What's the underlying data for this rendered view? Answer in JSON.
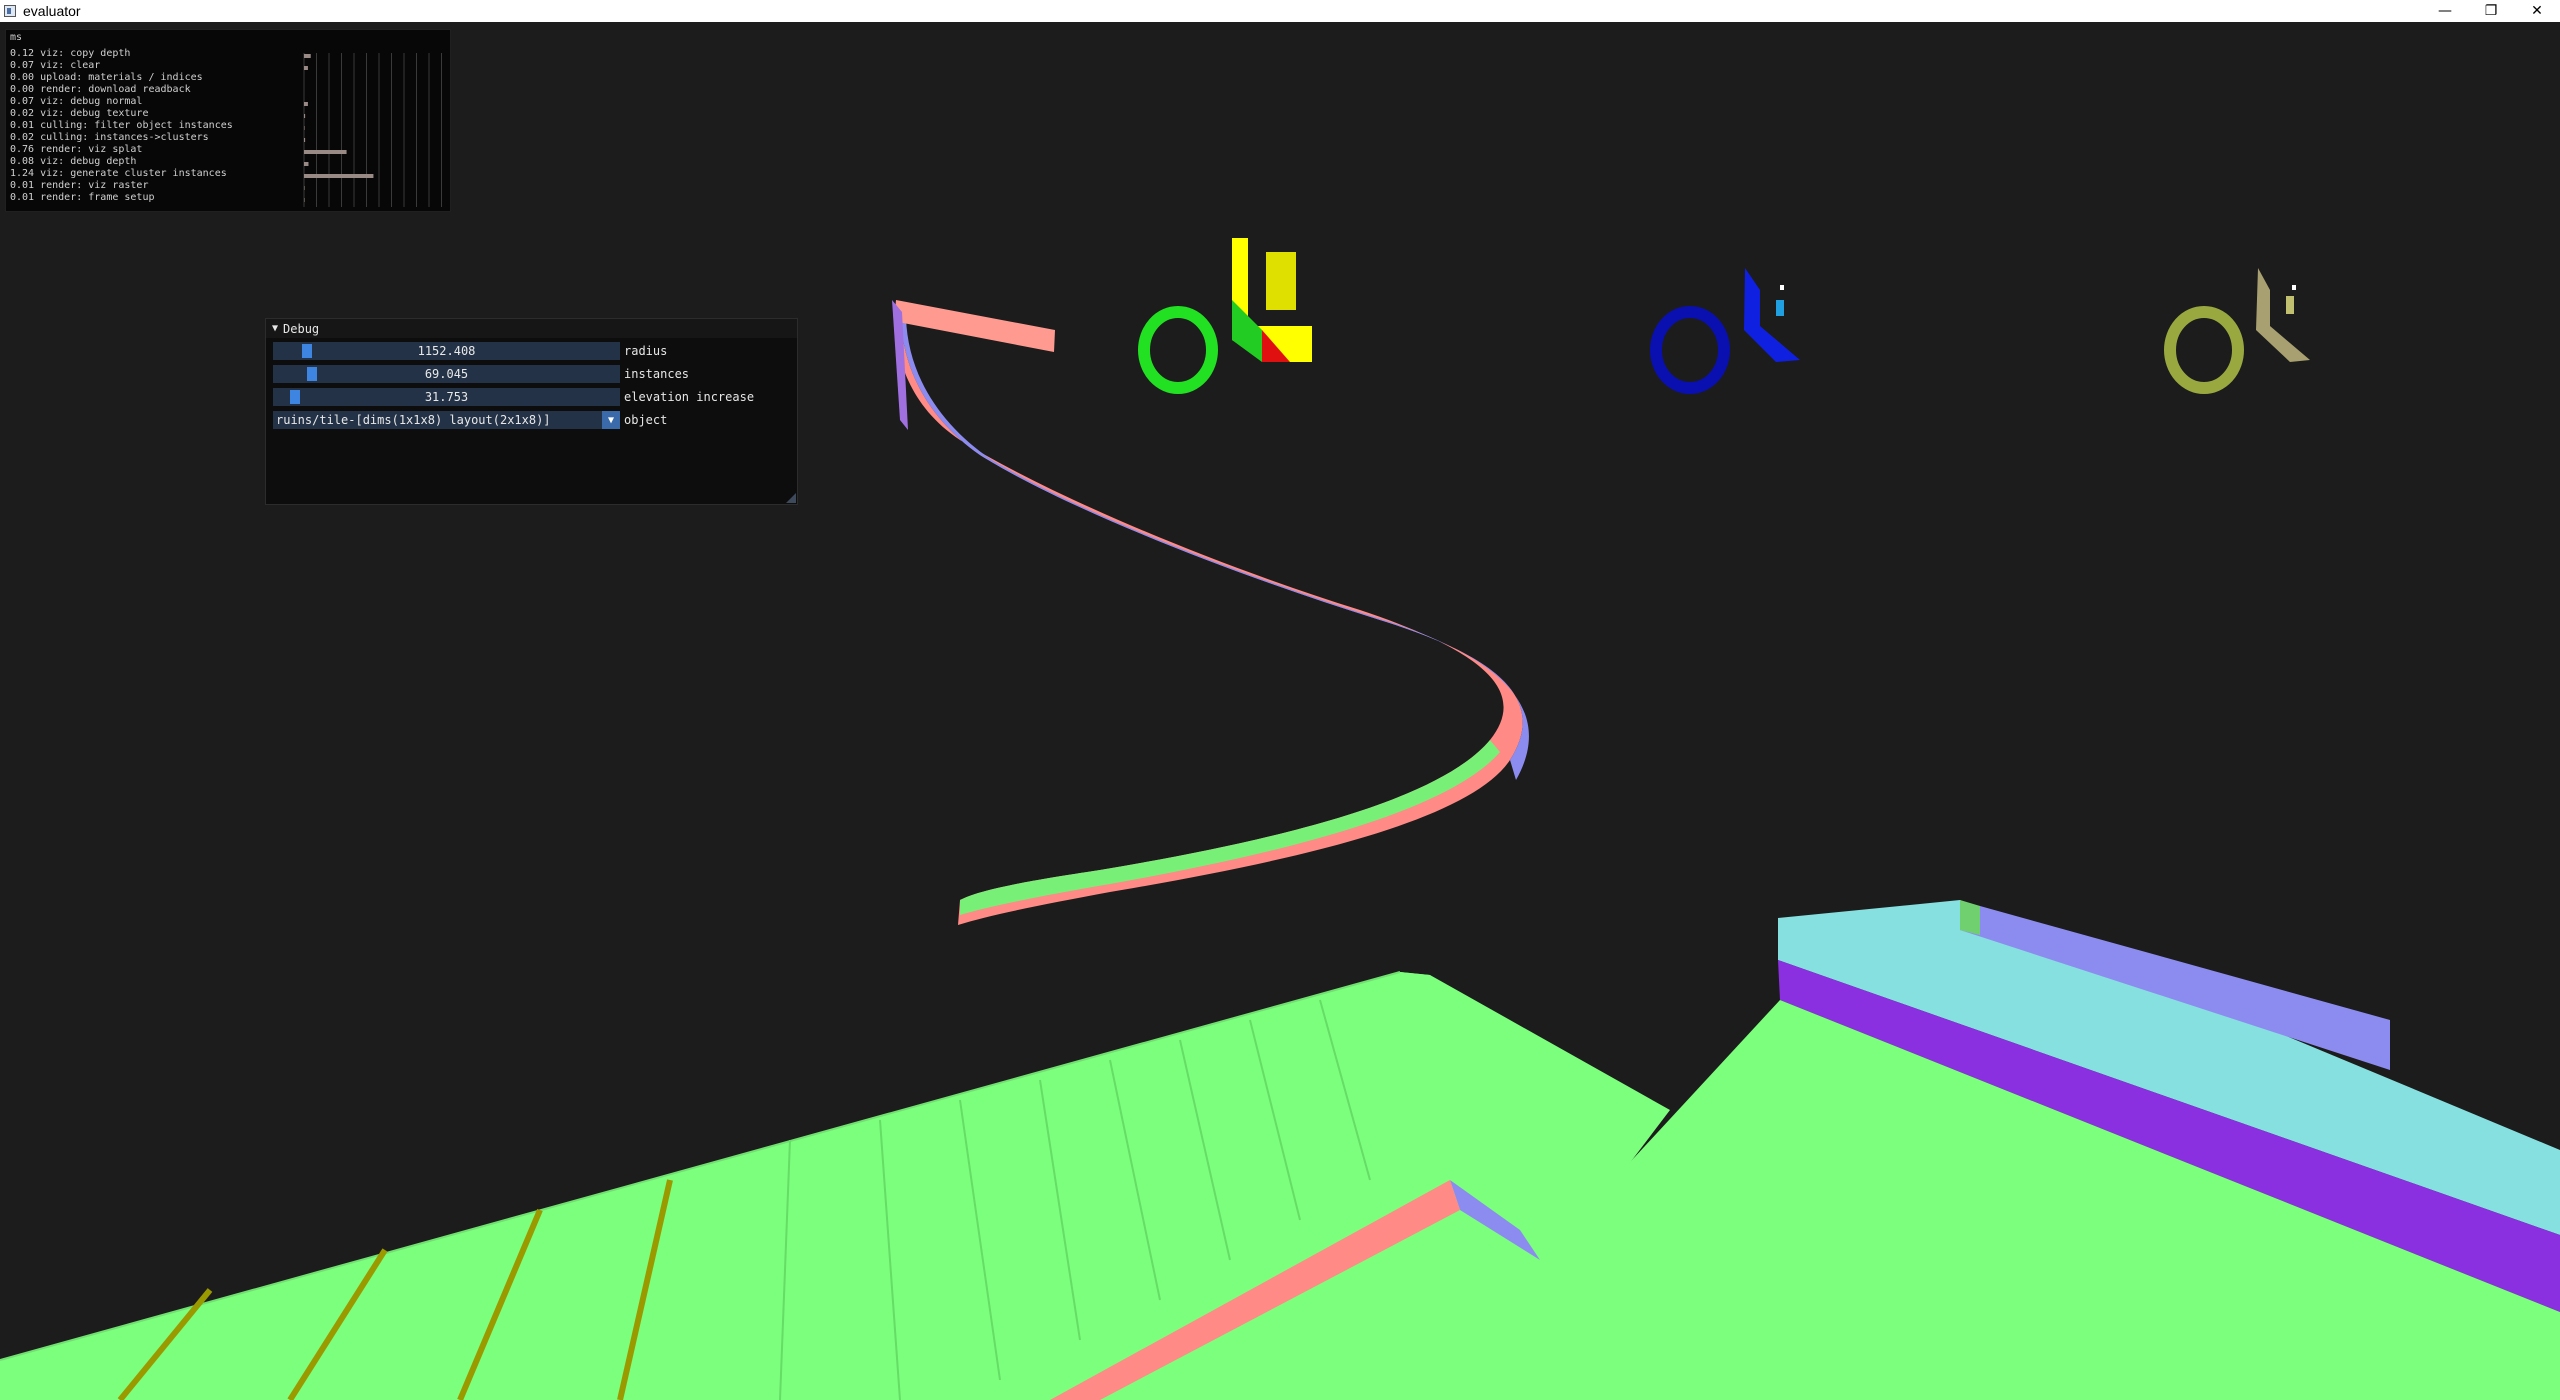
{
  "window": {
    "title": "evaluator",
    "minimize_glyph": "—",
    "restore_glyph": "❐",
    "close_glyph": "✕"
  },
  "timing": {
    "header": "ms",
    "entries": [
      {
        "ms": "0.12",
        "label": "viz: copy depth",
        "bar": 0.12
      },
      {
        "ms": "0.07",
        "label": "viz: clear",
        "bar": 0.07
      },
      {
        "ms": "0.00",
        "label": "upload: materials / indices",
        "bar": 0.0
      },
      {
        "ms": "0.00",
        "label": "render: download readback",
        "bar": 0.0
      },
      {
        "ms": "0.07",
        "label": "viz: debug normal",
        "bar": 0.07
      },
      {
        "ms": "0.02",
        "label": "viz: debug texture",
        "bar": 0.02
      },
      {
        "ms": "0.01",
        "label": "culling: filter object instances",
        "bar": 0.01
      },
      {
        "ms": "0.02",
        "label": "culling: instances->clusters",
        "bar": 0.02
      },
      {
        "ms": "0.76",
        "label": "render: viz splat",
        "bar": 0.76
      },
      {
        "ms": "0.08",
        "label": "viz: debug depth",
        "bar": 0.08
      },
      {
        "ms": "1.24",
        "label": "viz: generate cluster instances",
        "bar": 1.24
      },
      {
        "ms": "0.01",
        "label": "render: viz raster",
        "bar": 0.01
      },
      {
        "ms": "0.01",
        "label": "render: frame setup",
        "bar": 0.01
      }
    ]
  },
  "debug": {
    "title": "Debug",
    "collapse_glyph": "▼",
    "sliders": [
      {
        "value": "1152.408",
        "label": "radius",
        "fraction": 0.08
      },
      {
        "value": "69.045",
        "label": "instances",
        "fraction": 0.095
      },
      {
        "value": "31.753",
        "label": "elevation increase",
        "fraction": 0.045
      }
    ],
    "object": {
      "value": "ruins/tile-[dims(1x1x8) layout(2x1x8)]",
      "label": "object",
      "arrow_glyph": "▼"
    }
  },
  "colors": {
    "background": "#1c1c1c",
    "normal_up": "#80ff80",
    "normal_side_red": "#ff8080",
    "normal_side_blue": "#8080ff",
    "normal_cyan": "#80e0e0",
    "normal_purple": "#8a30e0",
    "normal_olive": "#9a9a00",
    "slider_bg": "#233247",
    "slider_grab": "#3d85e0"
  }
}
